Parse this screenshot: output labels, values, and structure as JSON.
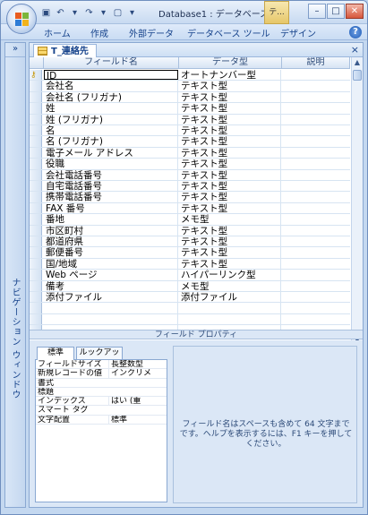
{
  "window": {
    "title": "Database1 : データベース ...",
    "context_tab": "テ..."
  },
  "ribbon": {
    "tabs": [
      "ホーム",
      "作成",
      "外部データ",
      "データベース ツール",
      "デザイン"
    ]
  },
  "nav_pane": {
    "label": "ナビゲーション ウィンドウ",
    "toggle": "»"
  },
  "document": {
    "tab_label": "T_連絡先",
    "close": "×"
  },
  "grid": {
    "headers": [
      "フィールド名",
      "データ型",
      "説明"
    ],
    "rows": [
      {
        "field": "ID",
        "type": "オートナンバー型"
      },
      {
        "field": "会社名",
        "type": "テキスト型"
      },
      {
        "field": "会社名 (フリガナ)",
        "type": "テキスト型"
      },
      {
        "field": "姓",
        "type": "テキスト型"
      },
      {
        "field": "姓 (フリガナ)",
        "type": "テキスト型"
      },
      {
        "field": "名",
        "type": "テキスト型"
      },
      {
        "field": "名 (フリガナ)",
        "type": "テキスト型"
      },
      {
        "field": "電子メール アドレス",
        "type": "テキスト型"
      },
      {
        "field": "役職",
        "type": "テキスト型"
      },
      {
        "field": "会社電話番号",
        "type": "テキスト型"
      },
      {
        "field": "自宅電話番号",
        "type": "テキスト型"
      },
      {
        "field": "携帯電話番号",
        "type": "テキスト型"
      },
      {
        "field": "FAX 番号",
        "type": "テキスト型"
      },
      {
        "field": "番地",
        "type": "メモ型"
      },
      {
        "field": "市区町村",
        "type": "テキスト型"
      },
      {
        "field": "都道府県",
        "type": "テキスト型"
      },
      {
        "field": "郵便番号",
        "type": "テキスト型"
      },
      {
        "field": "国/地域",
        "type": "テキスト型"
      },
      {
        "field": "Web ページ",
        "type": "ハイパーリンク型"
      },
      {
        "field": "備考",
        "type": "メモ型"
      },
      {
        "field": "添付ファイル",
        "type": "添付ファイル"
      },
      {
        "field": "",
        "type": ""
      },
      {
        "field": "",
        "type": ""
      },
      {
        "field": "",
        "type": ""
      }
    ]
  },
  "properties": {
    "bar_label": "フィールド プロパティ",
    "tabs": [
      "標準",
      "ルックアップ"
    ],
    "rows": [
      {
        "label": "フィールドサイズ",
        "value": "長整数型"
      },
      {
        "label": "新規レコードの値",
        "value": "インクリメ"
      },
      {
        "label": "書式",
        "value": ""
      },
      {
        "label": "標題",
        "value": ""
      },
      {
        "label": "インデックス",
        "value": "はい (重"
      },
      {
        "label": "スマート タグ",
        "value": ""
      },
      {
        "label": "文字配置",
        "value": "標準"
      }
    ],
    "help_text": "フィールド名はスペースも含めて 64 文字までです。ヘルプを表示するには、F1 キーを押してください。"
  }
}
